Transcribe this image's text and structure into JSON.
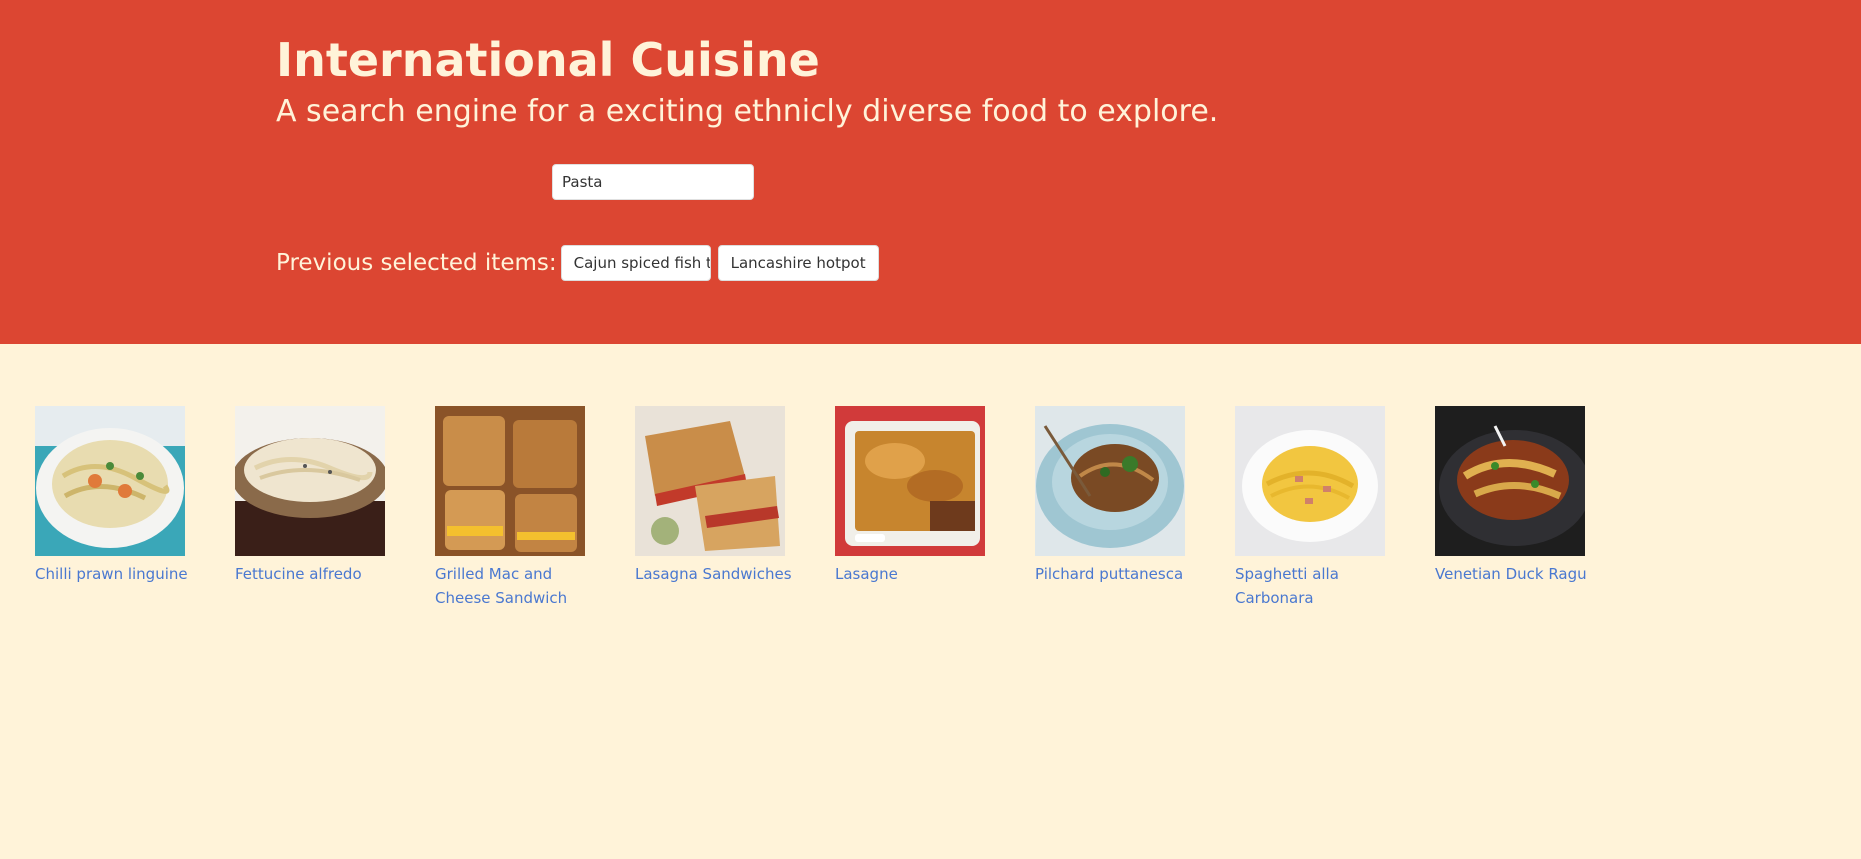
{
  "header": {
    "title": "International Cuisine",
    "subtitle": "A search engine for a exciting ethnicly diverse food to explore."
  },
  "search": {
    "value": "Pasta",
    "placeholder": ""
  },
  "previous": {
    "label": "Previous selected items:",
    "items": [
      {
        "label": "Cajun spiced fish ta"
      },
      {
        "label": "Lancashire hotpot"
      }
    ]
  },
  "colors": {
    "hero_bg": "#dc4632",
    "page_bg": "#fff3d9",
    "hero_text": "#fff3d9",
    "link": "#4a78d0"
  },
  "results": [
    {
      "title": "Chilli prawn linguine",
      "image": "chilli-prawn-linguine-photo"
    },
    {
      "title": "Fettucine alfredo",
      "image": "fettucine-alfredo-photo"
    },
    {
      "title": "Grilled Mac and Cheese Sandwich",
      "image": "grilled-mac-cheese-photo"
    },
    {
      "title": "Lasagna Sandwiches",
      "image": "lasagna-sandwiches-photo"
    },
    {
      "title": "Lasagne",
      "image": "lasagne-photo"
    },
    {
      "title": "Pilchard puttanesca",
      "image": "pilchard-puttanesca-photo"
    },
    {
      "title": "Spaghetti alla Carbonara",
      "image": "spaghetti-carbonara-photo"
    },
    {
      "title": "Venetian Duck Ragu",
      "image": "venetian-duck-ragu-photo"
    }
  ]
}
